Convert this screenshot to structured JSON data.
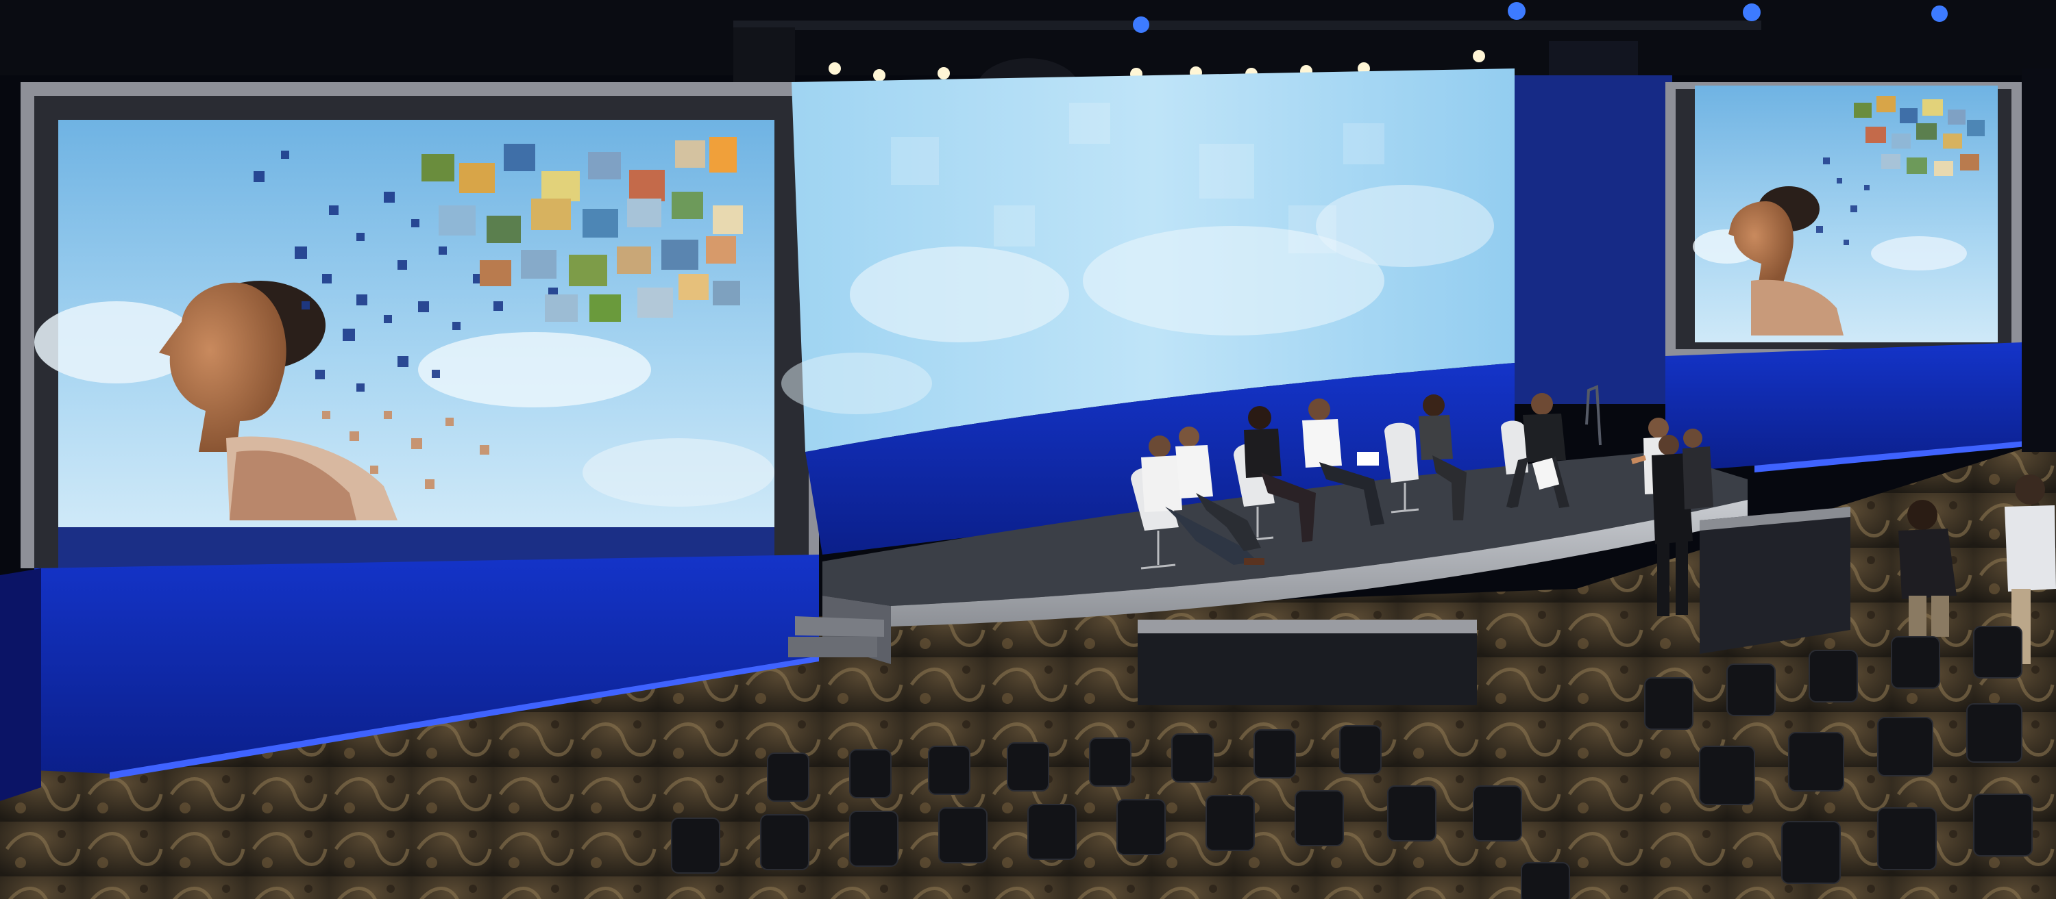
{
  "scene": {
    "description_icon": "photo-icon",
    "colors": {
      "sky": "#8fc6ea",
      "stage_blue": "#1f3fe0",
      "led_strip": "#2f54ff",
      "carpet": "#3a3226",
      "stage_floor": "#3d4148"
    }
  }
}
